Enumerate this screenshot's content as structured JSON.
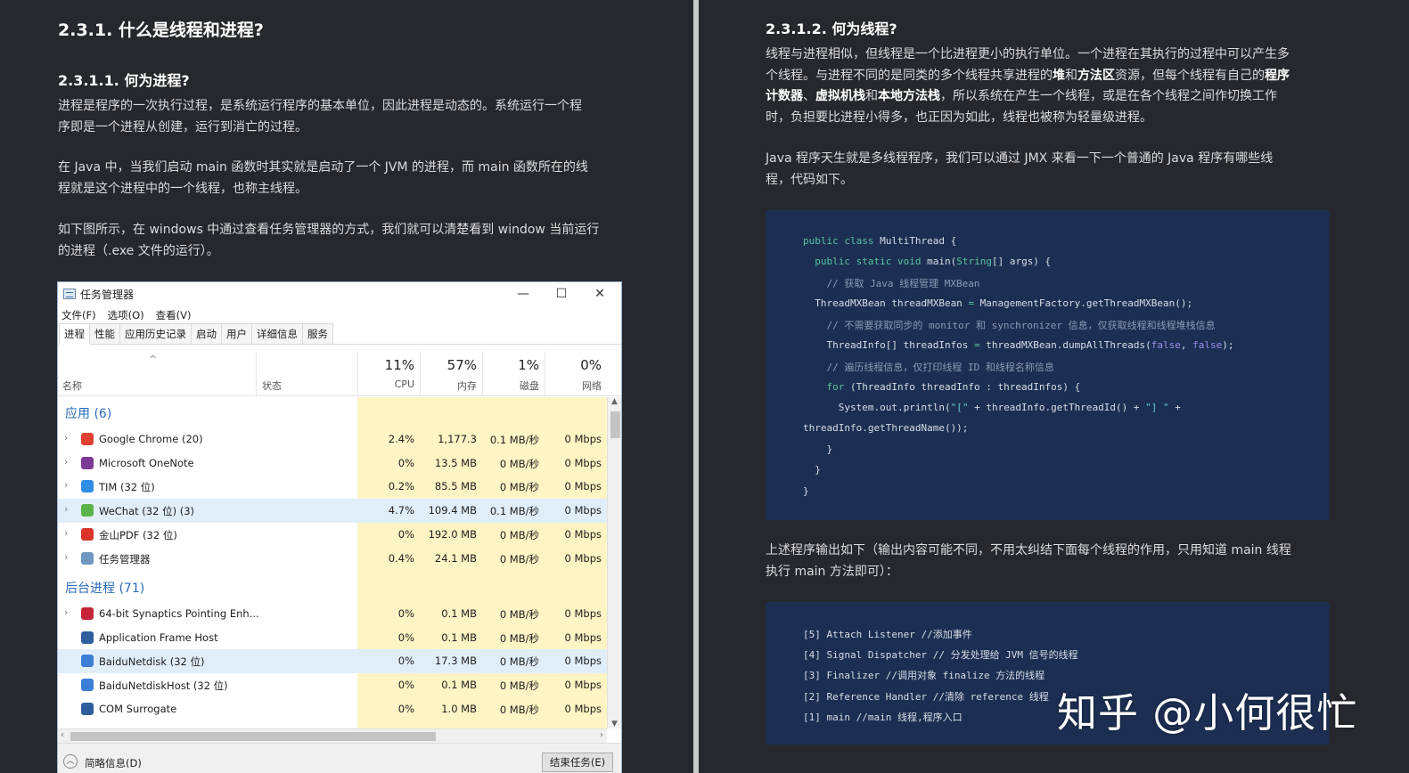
{
  "left": {
    "h2": "2.3.1. 什么是线程和进程?",
    "h3": "2.3.1.1. 何为进程?",
    "p1_l1": "进程是程序的一次执行过程，是系统运行程序的基本单位，因此进程是动态的。系统运行一个程",
    "p1_l2": "序即是一个进程从创建，运行到消亡的过程。",
    "p2_l1": "在 Java 中，当我们启动 main 函数时其实就是启动了一个 JVM 的进程，而 main 函数所在的线",
    "p2_l2": "程就是这个进程中的一个线程，也称主线程。",
    "p3_l1": "如下图所示，在 windows 中通过查看任务管理器的方式，我们就可以清楚看到 window 当前运行",
    "p3_l2": "的进程（.exe 文件的运行）。"
  },
  "taskmanager": {
    "title": "任务管理器",
    "win_min": "—",
    "win_max": "☐",
    "win_close": "✕",
    "menu": [
      "文件(F)",
      "选项(O)",
      "查看(V)"
    ],
    "tabs": [
      "进程",
      "性能",
      "应用历史记录",
      "启动",
      "用户",
      "详细信息",
      "服务"
    ],
    "sort_arrow": "^",
    "col_name": "名称",
    "col_status": "状态",
    "cpu_pct": "11%",
    "cpu_lbl": "CPU",
    "mem_pct": "57%",
    "mem_lbl": "内存",
    "disk_pct": "1%",
    "disk_lbl": "磁盘",
    "net_pct": "0%",
    "net_lbl": "网络",
    "group_apps": "应用 (6)",
    "group_bg": "后台进程 (71)",
    "apps": [
      {
        "name": "Google Chrome (20)",
        "cpu": "2.4%",
        "mem": "1,177.3",
        "disk": "0.1 MB/秒",
        "net": "0 Mbps",
        "icon": "chrome-icon"
      },
      {
        "name": "Microsoft OneNote",
        "cpu": "0%",
        "mem": "13.5 MB",
        "disk": "0 MB/秒",
        "net": "0 Mbps",
        "icon": "onenote-icon"
      },
      {
        "name": "TIM (32 位)",
        "cpu": "0.2%",
        "mem": "85.5 MB",
        "disk": "0 MB/秒",
        "net": "0 Mbps",
        "icon": "tim-icon"
      },
      {
        "name": "WeChat (32 位) (3)",
        "cpu": "4.7%",
        "mem": "109.4 MB",
        "disk": "0.1 MB/秒",
        "net": "0 Mbps",
        "icon": "wechat-icon"
      },
      {
        "name": "金山PDF (32 位)",
        "cpu": "0%",
        "mem": "192.0 MB",
        "disk": "0 MB/秒",
        "net": "0 Mbps",
        "icon": "pdf-icon"
      },
      {
        "name": "任务管理器",
        "cpu": "0.4%",
        "mem": "24.1 MB",
        "disk": "0 MB/秒",
        "net": "0 Mbps",
        "icon": "taskmgr-icon"
      }
    ],
    "bg": [
      {
        "name": "64-bit Synaptics Pointing Enh...",
        "cpu": "0%",
        "mem": "0.1 MB",
        "disk": "0 MB/秒",
        "net": "0 Mbps",
        "icon": "synaptics-icon"
      },
      {
        "name": "Application Frame Host",
        "cpu": "0%",
        "mem": "0.1 MB",
        "disk": "0 MB/秒",
        "net": "0 Mbps",
        "icon": "appframe-icon"
      },
      {
        "name": "BaiduNetdisk (32 位)",
        "cpu": "0%",
        "mem": "17.3 MB",
        "disk": "0 MB/秒",
        "net": "0 Mbps",
        "icon": "baidu-icon"
      },
      {
        "name": "BaiduNetdiskHost (32 位)",
        "cpu": "0%",
        "mem": "0.1 MB",
        "disk": "0 MB/秒",
        "net": "0 Mbps",
        "icon": "baidu-icon"
      },
      {
        "name": "COM Surrogate",
        "cpu": "0%",
        "mem": "1.0 MB",
        "disk": "0 MB/秒",
        "net": "0 Mbps",
        "icon": "com-icon"
      }
    ],
    "footer_less": "简略信息(D)",
    "footer_end": "结束任务(E)"
  },
  "right": {
    "h3": "2.3.1.2. 何为线程?",
    "p1_l1": "线程与进程相似，但线程是一个比进程更小的执行单位。一个进程在其执行的过程中可以产生多",
    "p1_l2a": "个线程。与进程不同的是同类的多个线程共享进程的",
    "p1_l2b": "堆",
    "p1_l2c": "和",
    "p1_l2d": "方法区",
    "p1_l2e": "资源，但每个线程有自己的",
    "p1_l2f": "程序",
    "p1_l3a": "计数器",
    "p1_l3b": "、",
    "p1_l3c": "虚拟机栈",
    "p1_l3d": "和",
    "p1_l3e": "本地方法栈",
    "p1_l3f": "，所以系统在产生一个线程，或是在各个线程之间作切换工作",
    "p1_l4": "时，负担要比进程小得多，也正因为如此，线程也被称为轻量级进程。",
    "p2_l1": "Java 程序天生就是多线程程序，我们可以通过 JMX 来看一下一个普通的 Java 程序有哪些线",
    "p2_l2": "程，代码如下。",
    "p3_l1": "上述程序输出如下（输出内容可能不同，不用太纠结下面每个线程的作用，只用知道 main 线程",
    "p3_l2": "执行 main 方法即可）："
  },
  "code1": {
    "l1a": "public class",
    "l1b": " MultiThread {",
    "l2a": "  public static void",
    "l2b": " main(",
    "l2c": "String",
    "l2d": "[] args) {",
    "l3": "    // 获取 Java 线程管理 MXBean",
    "l4a": "  ThreadMXBean threadMXBean ",
    "l4b": "=",
    "l4c": " ManagementFactory.getThreadMXBean();",
    "l5": "    // 不需要获取同步的 monitor 和 synchronizer 信息，仅获取线程和线程堆栈信息",
    "l6a": "    ThreadInfo[] threadInfos ",
    "l6b": "=",
    "l6c": " threadMXBean.dumpAllThreads(",
    "l6d": "false",
    "l6e": ", ",
    "l6f": "false",
    "l6g": ");",
    "l7": "    // 遍历线程信息，仅打印线程 ID 和线程名称信息",
    "l8a": "    for",
    "l8b": " (ThreadInfo threadInfo : threadInfos) {",
    "l9a": "      System.out.println(",
    "l9b": "\"[\"",
    "l9c": " + threadInfo.getThreadId() + ",
    "l9d": "\"] \"",
    "l9e": " +",
    "l10": "threadInfo.getThreadName());",
    "l11": "    }",
    "l12": "  }",
    "l13": "}"
  },
  "code2": {
    "l1": "[5] Attach Listener //添加事件",
    "l2": "[4] Signal Dispatcher // 分发处理给 JVM 信号的线程",
    "l3": "[3] Finalizer //调用对象 finalize 方法的线程",
    "l4": "[2] Reference Handler //清除 reference 线程",
    "l5": "[1] main //main 线程,程序入口"
  },
  "watermark": "知乎 @小何很忙"
}
